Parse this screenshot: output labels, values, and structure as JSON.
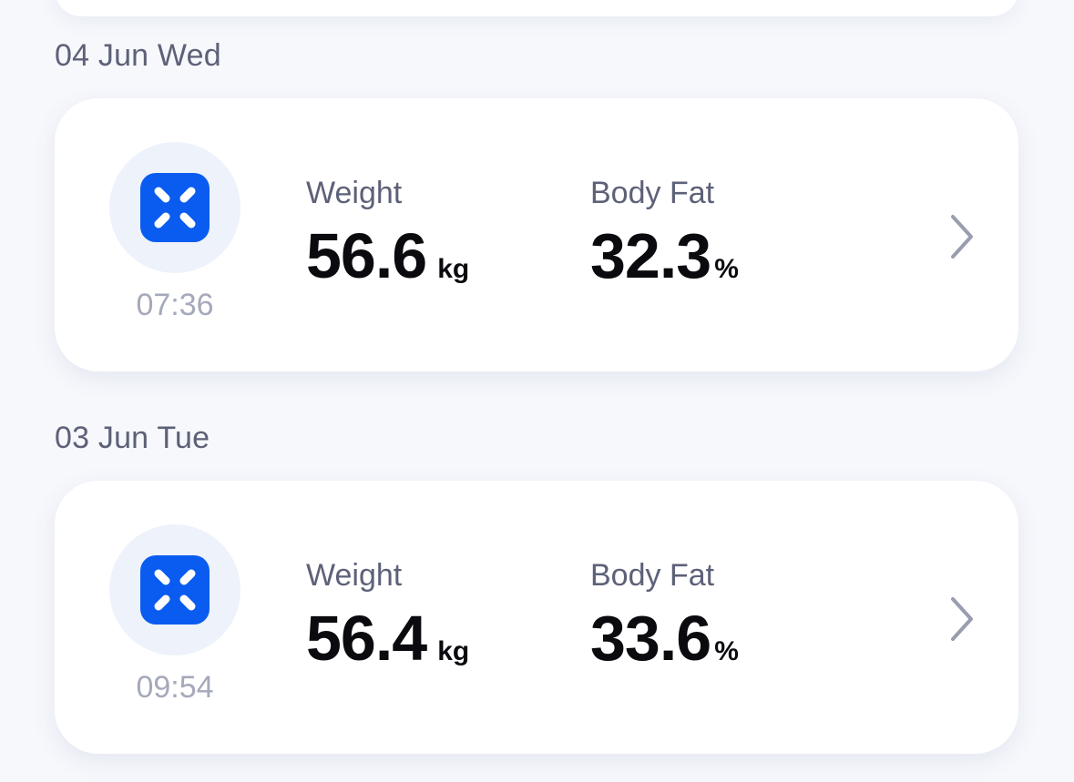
{
  "records": [
    {
      "date": "04 Jun Wed",
      "time": "07:36",
      "weight_label": "Weight",
      "weight_value": "56.6",
      "weight_unit": "kg",
      "fat_label": "Body Fat",
      "fat_value": "32.3",
      "fat_unit": "%",
      "icon": "scale-icon",
      "chevron_icon": "chevron-right-icon"
    },
    {
      "date": "03 Jun Tue",
      "time": "09:54",
      "weight_label": "Weight",
      "weight_value": "56.4",
      "weight_unit": "kg",
      "fat_label": "Body Fat",
      "fat_value": "33.6",
      "fat_unit": "%",
      "icon": "scale-icon",
      "chevron_icon": "chevron-right-icon"
    }
  ],
  "colors": {
    "accent": "#0a5cf0",
    "icon_background": "#edf2fb",
    "label_text": "#5d6178",
    "muted_text": "#a5a9ba",
    "value_text": "#0b0b0f"
  }
}
